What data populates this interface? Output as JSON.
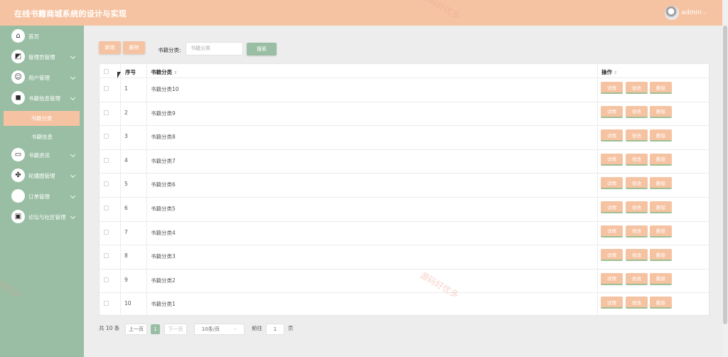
{
  "header": {
    "title": "在线书籍商城系统的设计与实现",
    "user": "admin"
  },
  "sidebar": {
    "items": [
      {
        "label": "首页",
        "icon": "home-icon",
        "glyph": "⌂",
        "chevron": false
      },
      {
        "label": "管理员管理",
        "icon": "crop-icon",
        "glyph": "◩",
        "chevron": true
      },
      {
        "label": "用户管理",
        "icon": "user-icon",
        "glyph": "☺",
        "chevron": true
      },
      {
        "label": "书籍信息管理",
        "icon": "book-icon",
        "glyph": "◼",
        "chevron": true
      },
      {
        "label": "书籍资讯",
        "icon": "wallet-icon",
        "glyph": "▭",
        "chevron": true
      },
      {
        "label": "轮播图管理",
        "icon": "grid-icon",
        "glyph": "✤",
        "chevron": true
      },
      {
        "label": "订单管理",
        "icon": "order-icon",
        "glyph": "",
        "chevron": true
      },
      {
        "label": "论坛与社区管理",
        "icon": "forum-icon",
        "glyph": "▣",
        "chevron": true
      }
    ],
    "submenu": [
      "书籍分类",
      "书籍信息"
    ]
  },
  "toolbar": {
    "add": "新增",
    "delete": "删除",
    "filter_label": "书籍分类:",
    "filter_placeholder": "书籍分类",
    "search": "搜索"
  },
  "table": {
    "headers": {
      "index": "序号",
      "category": "书籍分类",
      "actions": "操作"
    },
    "rows": [
      {
        "index": "1",
        "category": "书籍分类10"
      },
      {
        "index": "2",
        "category": "书籍分类9"
      },
      {
        "index": "3",
        "category": "书籍分类8"
      },
      {
        "index": "4",
        "category": "书籍分类7"
      },
      {
        "index": "5",
        "category": "书籍分类6"
      },
      {
        "index": "6",
        "category": "书籍分类5"
      },
      {
        "index": "7",
        "category": "书籍分类4"
      },
      {
        "index": "8",
        "category": "书籍分类3"
      },
      {
        "index": "9",
        "category": "书籍分类2"
      },
      {
        "index": "10",
        "category": "书籍分类1"
      }
    ],
    "actions": {
      "detail": "详情",
      "edit": "修改",
      "delete": "删除"
    }
  },
  "pagination": {
    "total": "共 10 条",
    "prev": "上一页",
    "page": "1",
    "next": "下一页",
    "size": "10条/页",
    "goto_label": "前往",
    "goto_value": "1",
    "goto_unit": "页"
  },
  "watermarks": [
    "源码好优多",
    "源码好优多",
    "好优多"
  ],
  "colors": {
    "accent": "#f6c3a2",
    "sidebar": "#99bea4",
    "background": "#ededed"
  }
}
